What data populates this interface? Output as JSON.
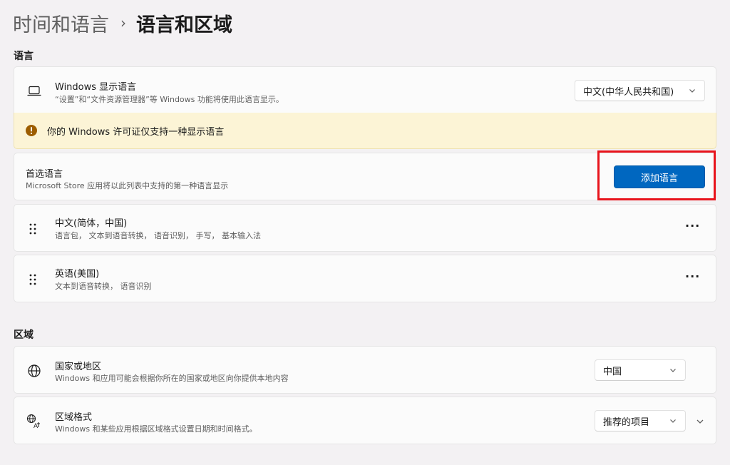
{
  "breadcrumb": {
    "parent": "时间和语言",
    "separator": "›",
    "current": "语言和区域"
  },
  "sections": {
    "language": "语言",
    "region": "区域"
  },
  "display_language": {
    "title": "Windows 显示语言",
    "subtitle": "“设置”和“文件资源管理器”等 Windows 功能将使用此语言显示。",
    "value": "中文(中华人民共和国)",
    "icon": "laptop-icon"
  },
  "license_warning": {
    "text": "你的 Windows 许可证仅支持一种显示语言",
    "icon": "warning-icon",
    "color": "#9d5d00"
  },
  "preferred_languages": {
    "title": "首选语言",
    "subtitle": "Microsoft Store 应用将以此列表中支持的第一种语言显示",
    "add_button": "添加语言"
  },
  "languages": [
    {
      "name": "中文(简体，中国)",
      "features": "语言包， 文本到语音转换， 语音识别， 手写， 基本输入法",
      "more": "···"
    },
    {
      "name": "英语(美国)",
      "features": "文本到语音转换， 语音识别",
      "more": "···"
    }
  ],
  "country": {
    "title": "国家或地区",
    "subtitle": "Windows 和应用可能会根据你所在的国家或地区向你提供本地内容",
    "value": "中国",
    "icon": "globe-icon"
  },
  "regional_format": {
    "title": "区域格式",
    "subtitle": "Windows 和某些应用根据区域格式设置日期和时间格式。",
    "value": "推荐的项目",
    "icon": "region-format-icon"
  },
  "colors": {
    "accent": "#0067c0",
    "highlight": "#e8141c",
    "warning_bg": "#fcf4d6"
  }
}
